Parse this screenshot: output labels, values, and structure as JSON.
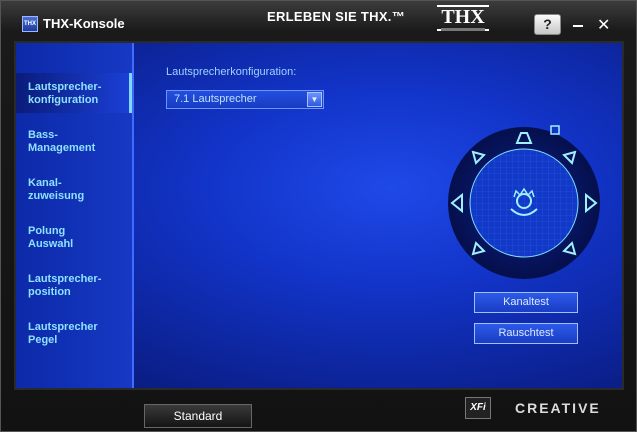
{
  "window": {
    "title": "THX-Konsole",
    "app_logo_text": "THX",
    "slogan": "ERLEBEN SIE THX.™",
    "brand_logo": "THX",
    "help_label": "?",
    "close_label": "✕"
  },
  "sidebar": {
    "items": [
      {
        "line1": "Lautsprecher-",
        "line2": "konfiguration",
        "active": true
      },
      {
        "line1": "Bass-",
        "line2": "Management",
        "active": false
      },
      {
        "line1": "Kanal-",
        "line2": "zuweisung",
        "active": false
      },
      {
        "line1": "Polung",
        "line2": "Auswahl",
        "active": false
      },
      {
        "line1": "Lautsprecher-",
        "line2": "position",
        "active": false
      },
      {
        "line1": "Lautsprecher",
        "line2": "Pegel",
        "active": false
      }
    ]
  },
  "main": {
    "config_label": "Lautsprecherkonfiguration:",
    "config_value": "7.1 Lautsprecher",
    "buttons": {
      "channel_test": "Kanaltest",
      "noise_test": "Rauschtest"
    }
  },
  "footer": {
    "standard_label": "Standard",
    "xfi_logo": "X-Fi",
    "creative_logo": "CREATIVE"
  },
  "colors": {
    "accent": "#7fd8ff",
    "panel": "#1234c8",
    "speaker": "#8fe7ff"
  }
}
